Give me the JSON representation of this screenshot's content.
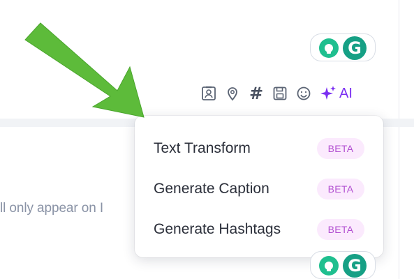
{
  "toolbar": {
    "icons": [
      "contact-card-icon",
      "location-pin-icon",
      "hashtag-icon",
      "save-icon",
      "emoji-icon"
    ],
    "hash_glyph": "#",
    "ai_label": "AI"
  },
  "ai_menu": {
    "items": [
      {
        "label": "Text Transform",
        "badge": "BETA"
      },
      {
        "label": "Generate Caption",
        "badge": "BETA"
      },
      {
        "label": "Generate Hashtags",
        "badge": "BETA"
      }
    ]
  },
  "editor": {
    "helper_text": "ll only appear on I"
  },
  "colors": {
    "accent_purple": "#7b2ff2",
    "badge_bg": "#fbeafd",
    "badge_text": "#b24fd1",
    "arrow_green": "#5dbb3a",
    "grammarly_green": "#16a085"
  }
}
